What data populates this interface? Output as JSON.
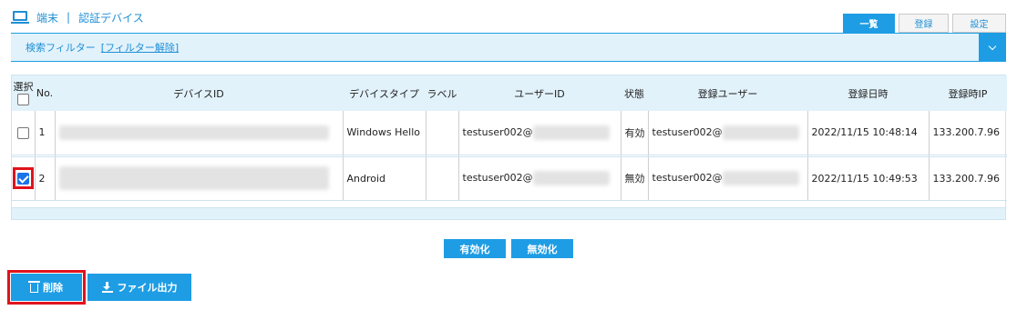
{
  "header": {
    "section": "端末",
    "separator": "|",
    "title": "認証デバイス"
  },
  "top_buttons": {
    "list": "一覧",
    "register": "登録",
    "settings": "設定"
  },
  "filter": {
    "label": "検索フィルター",
    "clear_link": "[フィルター解除]"
  },
  "table": {
    "headers": {
      "select": "選択",
      "no": "No.",
      "device_id": "デバイスID",
      "device_type": "デバイスタイプ",
      "label": "ラベル",
      "user_id": "ユーザーID",
      "status": "状態",
      "registered_user": "登録ユーザー",
      "registered_date": "登録日時",
      "registered_ip": "登録時IP"
    },
    "rows": [
      {
        "selected": false,
        "no": "1",
        "device_type": "Windows Hello",
        "label": "",
        "user_id": "testuser002@",
        "status": "有効",
        "registered_user": "testuser002@",
        "registered_date": "2022/11/15 10:48:14",
        "registered_ip": "133.200.7.96"
      },
      {
        "selected": true,
        "no": "2",
        "device_type": "Android",
        "label": "",
        "user_id": "testuser002@",
        "status": "無効",
        "registered_user": "testuser002@",
        "registered_date": "2022/11/15 10:49:53",
        "registered_ip": "133.200.7.96"
      }
    ]
  },
  "actions": {
    "enable": "有効化",
    "disable": "無効化",
    "delete": "削除",
    "export": "ファイル出力"
  },
  "colors": {
    "accent": "#1e9de4",
    "highlight": "#e0131c",
    "panel": "#e2f2fb"
  }
}
